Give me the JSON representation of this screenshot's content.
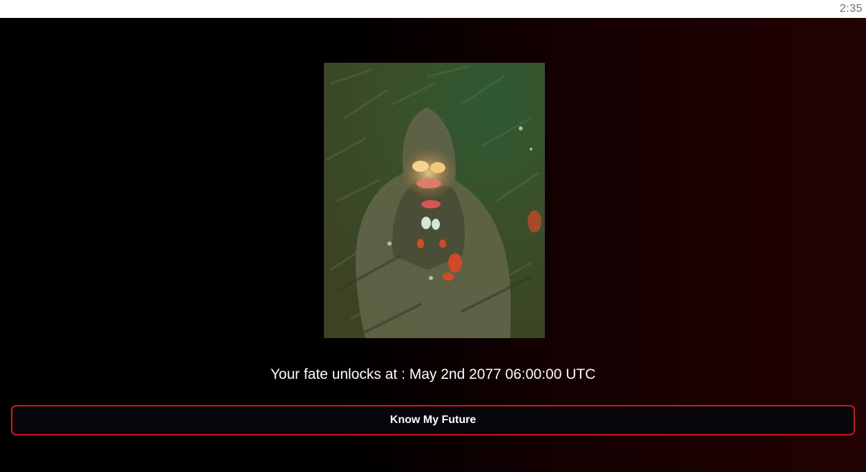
{
  "status_bar": {
    "time": "2:35"
  },
  "artwork": {
    "icon": "hooded-figure-painting",
    "palette": [
      "#3d4c27",
      "#2f5530",
      "#6a6a45",
      "#d24a2a",
      "#f0c87a",
      "#cfe6d8"
    ]
  },
  "fate": {
    "message": "Your fate unlocks at : May 2nd 2077 06:00:00 UTC"
  },
  "actions": {
    "know_future_label": "Know My Future",
    "accent_color": "#d0161a"
  }
}
